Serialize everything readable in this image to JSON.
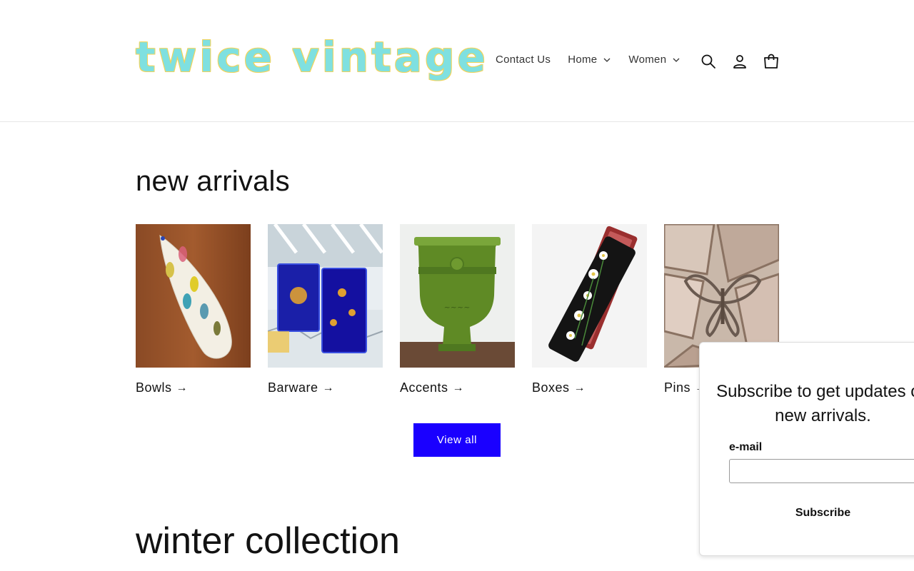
{
  "header": {
    "logo_text": "twice vintage",
    "nav": [
      {
        "label": "Contact Us"
      },
      {
        "label": "Home"
      },
      {
        "label": "Women"
      }
    ],
    "icons": [
      "search-icon",
      "account-icon",
      "cart-icon"
    ]
  },
  "new_arrivals": {
    "title": "new arrivals",
    "items": [
      {
        "label": "Bowls"
      },
      {
        "label": "Barware"
      },
      {
        "label": "Accents"
      },
      {
        "label": "Boxes"
      },
      {
        "label": "Pins"
      }
    ],
    "view_all_label": "View all"
  },
  "winter": {
    "title": "winter collection"
  },
  "subscribe_popup": {
    "title": "Subscribe to get updates on new arrivals.",
    "email_label": "e-mail",
    "email_value": "",
    "button_label": "Subscribe"
  },
  "colors": {
    "accent": "#1a00ff",
    "logo_fill": "#7fe0e0",
    "logo_outline": "#f2d35a"
  }
}
